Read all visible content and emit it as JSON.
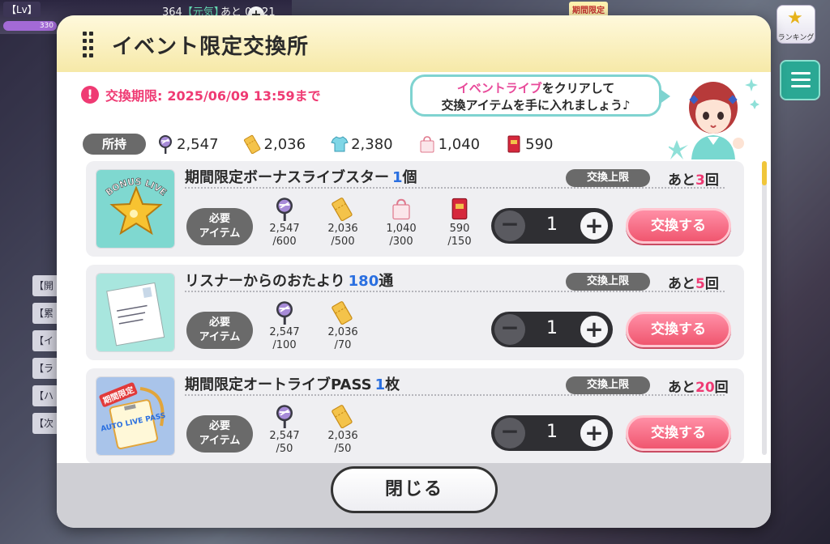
{
  "hud": {
    "level_label": "【Lv】",
    "level_bar_value": "330",
    "stamina": "364",
    "stamina_tag": "【元気】",
    "recover_timer": "あと 03:21",
    "limited_badge": "期間限定",
    "ranking_label": "ランキング"
  },
  "background_tabs": [
    "【開",
    "【累",
    "【イ",
    "【ラ",
    "【ハ",
    "【次"
  ],
  "modal": {
    "title": "イベント限定交換所",
    "deadline_label": "交換期限:",
    "deadline_value": "2025/06/09 13:59まで",
    "speech_highlight": "イベントライブ",
    "speech_line1_rest": "をクリアして",
    "speech_line2": "交換アイテムを手に入れましょう♪",
    "owned_label": "所持",
    "owned": [
      {
        "icon": "uchiwa-fan-icon",
        "value": "2,547"
      },
      {
        "icon": "ticket-icon",
        "value": "2,036"
      },
      {
        "icon": "tshirt-icon",
        "value": "2,380"
      },
      {
        "icon": "tote-bag-icon",
        "value": "1,040"
      },
      {
        "icon": "red-book-icon",
        "value": "590"
      }
    ],
    "limit_label": "交換上限",
    "remaining_prefix": "あと",
    "remaining_suffix": "回",
    "required_label_line1": "必要",
    "required_label_line2": "アイテム",
    "exchange_label": "交換する",
    "close_label": "閉じる",
    "items": [
      {
        "name": "期間限定ボーナスライブスター",
        "qty": "1",
        "unit": "個",
        "remaining": "3",
        "quantity": "1",
        "thumb": "bonus-live-star-icon",
        "thumb_text": "BONUS LIVE",
        "requirements": [
          {
            "icon": "uchiwa-fan-icon",
            "owned": "2,547",
            "cost": "/600"
          },
          {
            "icon": "ticket-icon",
            "owned": "2,036",
            "cost": "/500"
          },
          {
            "icon": "tote-bag-icon",
            "owned": "1,040",
            "cost": "/300"
          },
          {
            "icon": "red-book-icon",
            "owned": "590",
            "cost": "/150"
          }
        ]
      },
      {
        "name": "リスナーからのおたより",
        "qty": "180",
        "unit": "通",
        "remaining": "5",
        "quantity": "1",
        "thumb": "letter-icon",
        "requirements": [
          {
            "icon": "uchiwa-fan-icon",
            "owned": "2,547",
            "cost": "/100"
          },
          {
            "icon": "ticket-icon",
            "owned": "2,036",
            "cost": "/70"
          }
        ]
      },
      {
        "name": "期間限定オートライブPASS",
        "qty": "1",
        "unit": "枚",
        "remaining": "20",
        "quantity": "1",
        "thumb": "auto-live-pass-icon",
        "thumb_badge": "期間限定",
        "thumb_text": "AUTO LIVE PASS",
        "requirements": [
          {
            "icon": "uchiwa-fan-icon",
            "owned": "2,547",
            "cost": "/50"
          },
          {
            "icon": "ticket-icon",
            "owned": "2,036",
            "cost": "/50"
          }
        ]
      }
    ]
  }
}
